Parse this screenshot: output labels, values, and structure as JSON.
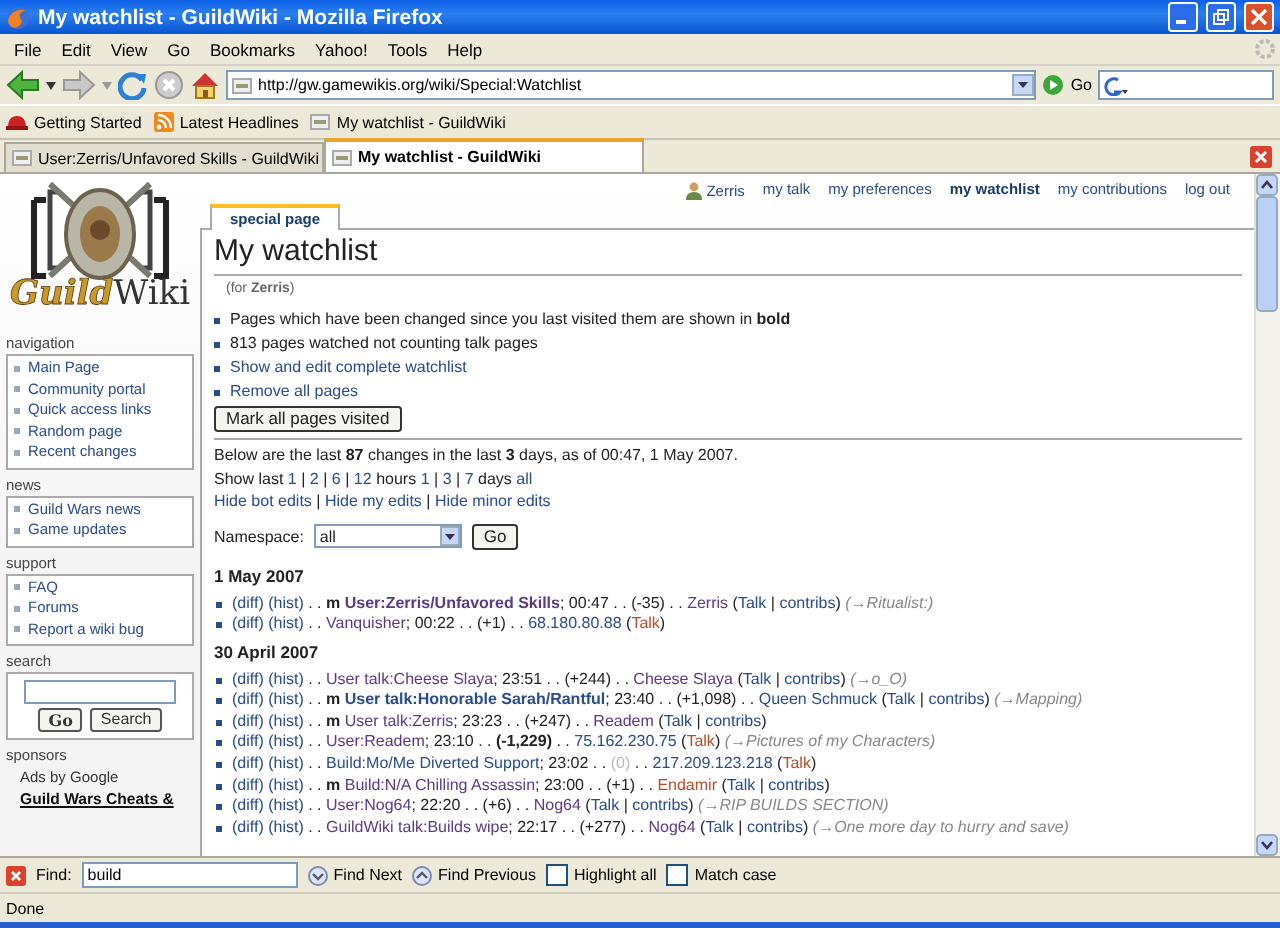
{
  "window": {
    "title": "My watchlist - GuildWiki - Mozilla Firefox"
  },
  "menu": [
    "File",
    "Edit",
    "View",
    "Go",
    "Bookmarks",
    "Yahoo!",
    "Tools",
    "Help"
  ],
  "address": {
    "url": "http://gw.gamewikis.org/wiki/Special:Watchlist",
    "go": "Go"
  },
  "bookmarks": [
    {
      "label": "Getting Started",
      "kind": "hat"
    },
    {
      "label": "Latest Headlines",
      "kind": "feed"
    },
    {
      "label": "My watchlist - GuildWiki",
      "kind": "page"
    }
  ],
  "tabs": [
    {
      "label": "User:Zerris/Unfavored Skills - GuildWiki",
      "selected": false
    },
    {
      "label": "My watchlist - GuildWiki",
      "selected": true
    }
  ],
  "personal": [
    {
      "label": "Zerris",
      "kind": "user",
      "selected": false
    },
    {
      "label": "my talk",
      "kind": "link",
      "selected": false
    },
    {
      "label": "my preferences",
      "kind": "link",
      "selected": false
    },
    {
      "label": "my watchlist",
      "kind": "link",
      "selected": true
    },
    {
      "label": "my contributions",
      "kind": "link",
      "selected": false
    },
    {
      "label": "log out",
      "kind": "link",
      "selected": false
    }
  ],
  "logo": {
    "first": "Guild",
    "second": "Wiki"
  },
  "sidebar": [
    {
      "title": "navigation",
      "items": [
        "Main Page",
        "Community portal",
        "Quick access links",
        "Random page",
        "Recent changes"
      ]
    },
    {
      "title": "news",
      "items": [
        "Guild Wars news",
        "Game updates"
      ]
    },
    {
      "title": "support",
      "items": [
        "FAQ",
        "Forums",
        "Report a wiki bug"
      ]
    }
  ],
  "search": {
    "title": "search",
    "buttons": [
      "Go",
      "Search"
    ]
  },
  "sponsors": {
    "title": "sponsors",
    "ads": "Ads by Google",
    "link": "Guild Wars Cheats &"
  },
  "page_tab": "special page",
  "title": "My watchlist",
  "subtitle": "(for **Zerris**)",
  "notes": [
    {
      "kind": "text",
      "text": "Pages which have been changed since you last visited them are shown in **bold**"
    },
    {
      "kind": "text",
      "text": "813 pages watched not counting talk pages"
    },
    {
      "kind": "link",
      "text": "Show and edit complete watchlist"
    },
    {
      "kind": "link",
      "text": "Remove all pages"
    }
  ],
  "mark_button": "Mark all pages visited",
  "summary": "Below are the last **87** changes in the last **3** days, as of 00:47, 1 May 2007.",
  "show_last": [
    {
      "kind": "text",
      "text": "Show last"
    },
    {
      "kind": "link",
      "text": "1"
    },
    {
      "kind": "text",
      "text": "|"
    },
    {
      "kind": "link",
      "text": "2"
    },
    {
      "kind": "text",
      "text": "|"
    },
    {
      "kind": "link",
      "text": "6"
    },
    {
      "kind": "text",
      "text": "|"
    },
    {
      "kind": "link",
      "text": "12"
    },
    {
      "kind": "text",
      "text": "hours"
    },
    {
      "kind": "link",
      "text": "1"
    },
    {
      "kind": "text",
      "text": "|"
    },
    {
      "kind": "link",
      "text": "3"
    },
    {
      "kind": "text",
      "text": "|"
    },
    {
      "kind": "link",
      "text": "7"
    },
    {
      "kind": "text",
      "text": "days"
    },
    {
      "kind": "link",
      "text": "all"
    }
  ],
  "hide": [
    {
      "kind": "link",
      "text": "Hide bot edits"
    },
    {
      "kind": "text",
      "text": "|"
    },
    {
      "kind": "link",
      "text": "Hide my edits"
    },
    {
      "kind": "text",
      "text": "|"
    },
    {
      "kind": "link",
      "text": "Hide minor edits"
    }
  ],
  "namespace": {
    "label": "Namespace:",
    "value": "all",
    "button": "Go"
  },
  "days": [
    {
      "date": "1 May 2007",
      "changes": [
        {
          "segments": [
            {
              "kind": "link",
              "text": "(diff)"
            },
            {
              "kind": "link",
              "text": "(hist)"
            },
            {
              "kind": "text",
              "text": ". ."
            },
            {
              "kind": "minor",
              "text": "m"
            },
            {
              "kind": "page",
              "text": "User:Zerris/Unfavored Skills"
            },
            {
              "kind": "text",
              "text": "; 00:47 . . (-35) . ."
            },
            {
              "kind": "visited",
              "text": "Zerris"
            },
            {
              "kind": "text",
              "text": "("
            },
            {
              "kind": "link",
              "text": "Talk"
            },
            {
              "kind": "text",
              "text": "|"
            },
            {
              "kind": "link",
              "text": "contribs"
            },
            {
              "kind": "text",
              "text": ")"
            },
            {
              "kind": "comment",
              "text": "(→Ritualist:)"
            }
          ]
        },
        {
          "segments": [
            {
              "kind": "link",
              "text": "(diff)"
            },
            {
              "kind": "link",
              "text": "(hist)"
            },
            {
              "kind": "text",
              "text": ". ."
            },
            {
              "kind": "visited",
              "text": "Vanquisher"
            },
            {
              "kind": "text",
              "text": "; 00:22 . . (+1) . ."
            },
            {
              "kind": "link",
              "text": "68.180.80.88"
            },
            {
              "kind": "text",
              "text": "("
            },
            {
              "kind": "red",
              "text": "Talk"
            },
            {
              "kind": "text",
              "text": ")"
            }
          ]
        }
      ]
    },
    {
      "date": "30 April 2007",
      "changes": [
        {
          "segments": [
            {
              "kind": "link",
              "text": "(diff)"
            },
            {
              "kind": "link",
              "text": "(hist)"
            },
            {
              "kind": "text",
              "text": ". ."
            },
            {
              "kind": "visited",
              "text": "User talk:Cheese Slaya"
            },
            {
              "kind": "text",
              "text": "; 23:51 . . (+244) . ."
            },
            {
              "kind": "visited",
              "text": "Cheese Slaya"
            },
            {
              "kind": "text",
              "text": "("
            },
            {
              "kind": "link",
              "text": "Talk"
            },
            {
              "kind": "text",
              "text": "|"
            },
            {
              "kind": "link",
              "text": "contribs"
            },
            {
              "kind": "text",
              "text": ")"
            },
            {
              "kind": "comment",
              "text": "(→o_O)"
            }
          ]
        },
        {
          "segments": [
            {
              "kind": "link",
              "text": "(diff)"
            },
            {
              "kind": "link",
              "text": "(hist)"
            },
            {
              "kind": "text",
              "text": ". ."
            },
            {
              "kind": "minor",
              "text": "m"
            },
            {
              "kind": "bold-link",
              "text": "User talk:Honorable Sarah/Rantful"
            },
            {
              "kind": "text",
              "text": "; 23:40 . . (+1,098) . ."
            },
            {
              "kind": "link",
              "text": "Queen Schmuck"
            },
            {
              "kind": "text",
              "text": "("
            },
            {
              "kind": "link",
              "text": "Talk"
            },
            {
              "kind": "text",
              "text": "|"
            },
            {
              "kind": "link",
              "text": "contribs"
            },
            {
              "kind": "text",
              "text": ")"
            },
            {
              "kind": "comment",
              "text": "(→Mapping)"
            }
          ]
        },
        {
          "segments": [
            {
              "kind": "link",
              "text": "(diff)"
            },
            {
              "kind": "link",
              "text": "(hist)"
            },
            {
              "kind": "text",
              "text": ". ."
            },
            {
              "kind": "minor",
              "text": "m"
            },
            {
              "kind": "visited",
              "text": "User talk:Zerris"
            },
            {
              "kind": "text",
              "text": "; 23:23 . . (+247) . ."
            },
            {
              "kind": "visited",
              "text": "Readem"
            },
            {
              "kind": "text",
              "text": "("
            },
            {
              "kind": "link",
              "text": "Talk"
            },
            {
              "kind": "text",
              "text": "|"
            },
            {
              "kind": "link",
              "text": "contribs"
            },
            {
              "kind": "text",
              "text": ")"
            }
          ]
        },
        {
          "segments": [
            {
              "kind": "link",
              "text": "(diff)"
            },
            {
              "kind": "link",
              "text": "(hist)"
            },
            {
              "kind": "text",
              "text": ". ."
            },
            {
              "kind": "visited",
              "text": "User:Readem"
            },
            {
              "kind": "text",
              "text": "; 23:10 . ."
            },
            {
              "kind": "strong",
              "text": "(-1,229)"
            },
            {
              "kind": "text",
              "text": ". ."
            },
            {
              "kind": "link",
              "text": "75.162.230.75"
            },
            {
              "kind": "text",
              "text": "("
            },
            {
              "kind": "red",
              "text": "Talk"
            },
            {
              "kind": "text",
              "text": ")"
            },
            {
              "kind": "comment",
              "text": "(→Pictures of my Characters)"
            }
          ]
        },
        {
          "segments": [
            {
              "kind": "link",
              "text": "(diff)"
            },
            {
              "kind": "link",
              "text": "(hist)"
            },
            {
              "kind": "text",
              "text": ". ."
            },
            {
              "kind": "link",
              "text": "Build:Mo/Me Diverted Support"
            },
            {
              "kind": "text",
              "text": "; 23:02 . ."
            },
            {
              "kind": "muted",
              "text": "(0)"
            },
            {
              "kind": "text",
              "text": ". ."
            },
            {
              "kind": "link",
              "text": "217.209.123.218"
            },
            {
              "kind": "text",
              "text": "("
            },
            {
              "kind": "red",
              "text": "Talk"
            },
            {
              "kind": "text",
              "text": ")"
            }
          ]
        },
        {
          "segments": [
            {
              "kind": "link",
              "text": "(diff)"
            },
            {
              "kind": "link",
              "text": "(hist)"
            },
            {
              "kind": "text",
              "text": ". ."
            },
            {
              "kind": "minor",
              "text": "m"
            },
            {
              "kind": "visited",
              "text": "Build:N/A Chilling Assassin"
            },
            {
              "kind": "text",
              "text": "; 23:00 . . (+1) . ."
            },
            {
              "kind": "red",
              "text": "Endamir"
            },
            {
              "kind": "text",
              "text": "("
            },
            {
              "kind": "link",
              "text": "Talk"
            },
            {
              "kind": "text",
              "text": "|"
            },
            {
              "kind": "link",
              "text": "contribs"
            },
            {
              "kind": "text",
              "text": ")"
            }
          ]
        },
        {
          "segments": [
            {
              "kind": "link",
              "text": "(diff)"
            },
            {
              "kind": "link",
              "text": "(hist)"
            },
            {
              "kind": "text",
              "text": ". ."
            },
            {
              "kind": "visited",
              "text": "User:Nog64"
            },
            {
              "kind": "text",
              "text": "; 22:20 . . (+6) . ."
            },
            {
              "kind": "visited",
              "text": "Nog64"
            },
            {
              "kind": "text",
              "text": "("
            },
            {
              "kind": "link",
              "text": "Talk"
            },
            {
              "kind": "text",
              "text": "|"
            },
            {
              "kind": "link",
              "text": "contribs"
            },
            {
              "kind": "text",
              "text": ")"
            },
            {
              "kind": "comment",
              "text": "(→RIP BUILDS SECTION)"
            }
          ]
        },
        {
          "segments": [
            {
              "kind": "link",
              "text": "(diff)"
            },
            {
              "kind": "link",
              "text": "(hist)"
            },
            {
              "kind": "text",
              "text": ". ."
            },
            {
              "kind": "visited",
              "text": "GuildWiki talk:Builds wipe"
            },
            {
              "kind": "text",
              "text": "; 22:17 . . (+277) . ."
            },
            {
              "kind": "visited",
              "text": "Nog64"
            },
            {
              "kind": "text",
              "text": "("
            },
            {
              "kind": "link",
              "text": "Talk"
            },
            {
              "kind": "text",
              "text": "|"
            },
            {
              "kind": "link",
              "text": "contribs"
            },
            {
              "kind": "text",
              "text": ")"
            },
            {
              "kind": "comment",
              "text": "(→One more day to hurry and save)"
            }
          ]
        }
      ]
    }
  ],
  "findbar": {
    "label": "Find:",
    "value": "build",
    "buttons": [
      {
        "label": "Find Next",
        "kind": "next"
      },
      {
        "label": "Find Previous",
        "kind": "previous"
      }
    ],
    "options": [
      {
        "label": "Highlight all",
        "checked": false
      },
      {
        "label": "Match case",
        "checked": false
      }
    ]
  },
  "status": "Done"
}
